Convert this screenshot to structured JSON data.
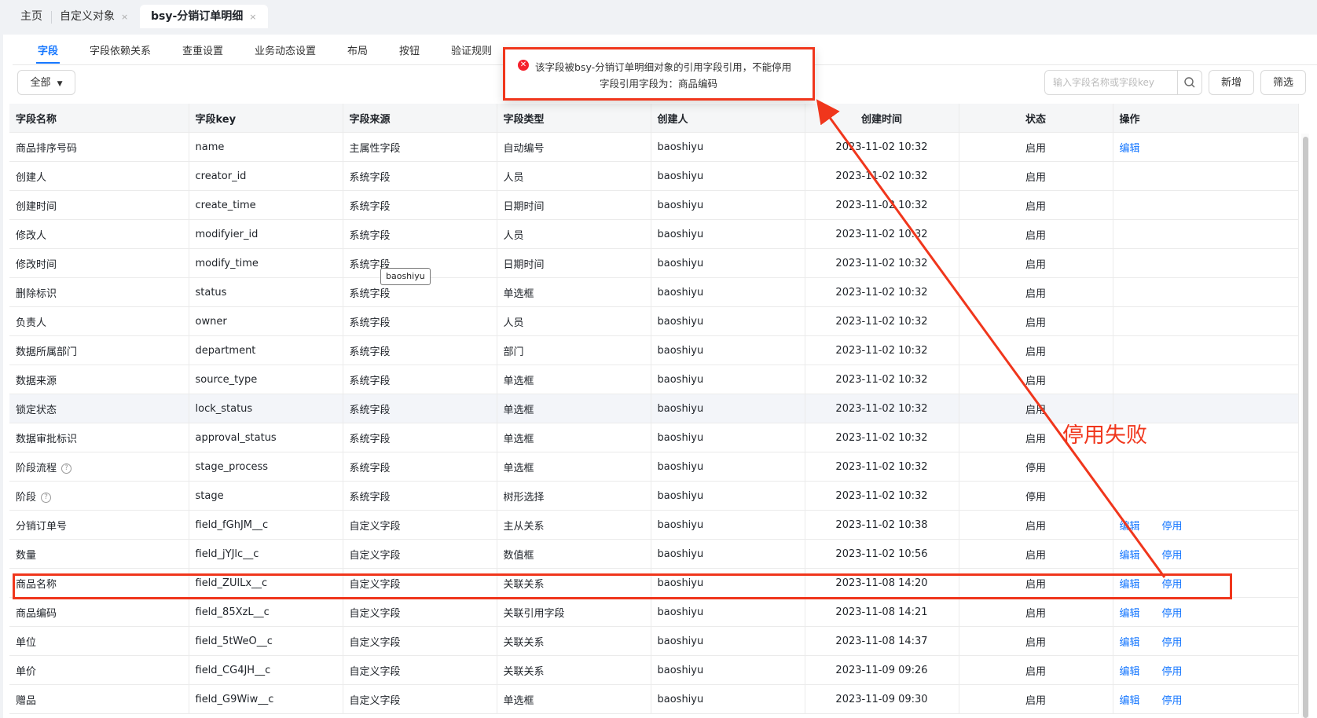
{
  "top_tabs": [
    {
      "label": "主页",
      "closable": false,
      "active": false
    },
    {
      "label": "自定义对象",
      "closable": true,
      "active": false
    },
    {
      "label": "bsy-分销订单明细",
      "closable": true,
      "active": true
    }
  ],
  "close_glyph": "×",
  "sub_tabs": [
    "字段",
    "字段依赖关系",
    "查重设置",
    "业务动态设置",
    "布局",
    "按钮",
    "验证规则"
  ],
  "toolbar": {
    "filter_dropdown": "全部",
    "search_placeholder": "输入字段名称或字段key",
    "add_label": "新增",
    "filter_label": "筛选"
  },
  "columns": [
    "字段名称",
    "字段key",
    "字段来源",
    "字段类型",
    "创建人",
    "创建时间",
    "状态",
    "操作"
  ],
  "rows": [
    {
      "name": "商品排序号码",
      "key": "name",
      "source": "主属性字段",
      "type": "自动编号",
      "creator": "baoshiyu",
      "time": "2023-11-02 10:32",
      "status": "启用",
      "actions": [
        "编辑"
      ]
    },
    {
      "name": "创建人",
      "key": "creator_id",
      "source": "系统字段",
      "type": "人员",
      "creator": "baoshiyu",
      "time": "2023-11-02 10:32",
      "status": "启用",
      "actions": []
    },
    {
      "name": "创建时间",
      "key": "create_time",
      "source": "系统字段",
      "type": "日期时间",
      "creator": "baoshiyu",
      "time": "2023-11-02 10:32",
      "status": "启用",
      "actions": []
    },
    {
      "name": "修改人",
      "key": "modifyier_id",
      "source": "系统字段",
      "type": "人员",
      "creator": "baoshiyu",
      "time": "2023-11-02 10:32",
      "status": "启用",
      "actions": []
    },
    {
      "name": "修改时间",
      "key": "modify_time",
      "source": "系统字段",
      "type": "日期时间",
      "creator": "baoshiyu",
      "time": "2023-11-02 10:32",
      "status": "启用",
      "actions": []
    },
    {
      "name": "删除标识",
      "key": "status",
      "source": "系统字段",
      "type": "单选框",
      "creator": "baoshiyu",
      "time": "2023-11-02 10:32",
      "status": "启用",
      "actions": []
    },
    {
      "name": "负责人",
      "key": "owner",
      "source": "系统字段",
      "type": "人员",
      "creator": "baoshiyu",
      "time": "2023-11-02 10:32",
      "status": "启用",
      "actions": []
    },
    {
      "name": "数据所属部门",
      "key": "department",
      "source": "系统字段",
      "type": "部门",
      "creator": "baoshiyu",
      "time": "2023-11-02 10:32",
      "status": "启用",
      "actions": []
    },
    {
      "name": "数据来源",
      "key": "source_type",
      "source": "系统字段",
      "type": "单选框",
      "creator": "baoshiyu",
      "time": "2023-11-02 10:32",
      "status": "启用",
      "actions": []
    },
    {
      "name": "锁定状态",
      "key": "lock_status",
      "source": "系统字段",
      "type": "单选框",
      "creator": "baoshiyu",
      "time": "2023-11-02 10:32",
      "status": "启用",
      "actions": [],
      "hovered": true
    },
    {
      "name": "数据审批标识",
      "key": "approval_status",
      "source": "系统字段",
      "type": "单选框",
      "creator": "baoshiyu",
      "time": "2023-11-02 10:32",
      "status": "启用",
      "actions": []
    },
    {
      "name": "阶段流程",
      "key": "stage_process",
      "source": "系统字段",
      "type": "单选框",
      "creator": "baoshiyu",
      "time": "2023-11-02 10:32",
      "status": "停用",
      "actions": [],
      "help": true
    },
    {
      "name": "阶段",
      "key": "stage",
      "source": "系统字段",
      "type": "树形选择",
      "creator": "baoshiyu",
      "time": "2023-11-02 10:32",
      "status": "停用",
      "actions": [],
      "help": true
    },
    {
      "name": "分销订单号",
      "key": "field_fGhJM__c",
      "source": "自定义字段",
      "type": "主从关系",
      "creator": "baoshiyu",
      "time": "2023-11-02 10:38",
      "status": "启用",
      "actions": [
        "编辑",
        "停用"
      ]
    },
    {
      "name": "数量",
      "key": "field_jYJlc__c",
      "source": "自定义字段",
      "type": "数值框",
      "creator": "baoshiyu",
      "time": "2023-11-02 10:56",
      "status": "启用",
      "actions": [
        "编辑",
        "停用"
      ]
    },
    {
      "name": "商品名称",
      "key": "field_ZUlLx__c",
      "source": "自定义字段",
      "type": "关联关系",
      "creator": "baoshiyu",
      "time": "2023-11-08 14:20",
      "status": "启用",
      "actions": [
        "编辑",
        "停用"
      ]
    },
    {
      "name": "商品编码",
      "key": "field_85XzL__c",
      "source": "自定义字段",
      "type": "关联引用字段",
      "creator": "baoshiyu",
      "time": "2023-11-08 14:21",
      "status": "启用",
      "actions": [
        "编辑",
        "停用"
      ]
    },
    {
      "name": "单位",
      "key": "field_5tWeO__c",
      "source": "自定义字段",
      "type": "关联关系",
      "creator": "baoshiyu",
      "time": "2023-11-08 14:37",
      "status": "启用",
      "actions": [
        "编辑",
        "停用"
      ]
    },
    {
      "name": "单价",
      "key": "field_CG4JH__c",
      "source": "自定义字段",
      "type": "关联关系",
      "creator": "baoshiyu",
      "time": "2023-11-09 09:26",
      "status": "启用",
      "actions": [
        "编辑",
        "停用"
      ]
    },
    {
      "name": "赠品",
      "key": "field_G9Wiw__c",
      "source": "自定义字段",
      "type": "单选框",
      "creator": "baoshiyu",
      "time": "2023-11-09 09:30",
      "status": "启用",
      "actions": [
        "编辑",
        "停用"
      ]
    }
  ],
  "error_toast": {
    "line1": "该字段被bsy-分销订单明细对象的引用字段引用，不能停用",
    "line2": "字段引用字段为：商品编码"
  },
  "tooltip": "baoshiyu",
  "annotation": "停用失败",
  "icons": {
    "error": "error-circle-icon",
    "search": "search-icon",
    "dropdown": "caret-down-icon",
    "help": "help-circle-icon",
    "close": "close-icon"
  },
  "colors": {
    "accent": "#1677ff",
    "annotation_red": "#f0361c",
    "error_red": "#f5222d"
  }
}
